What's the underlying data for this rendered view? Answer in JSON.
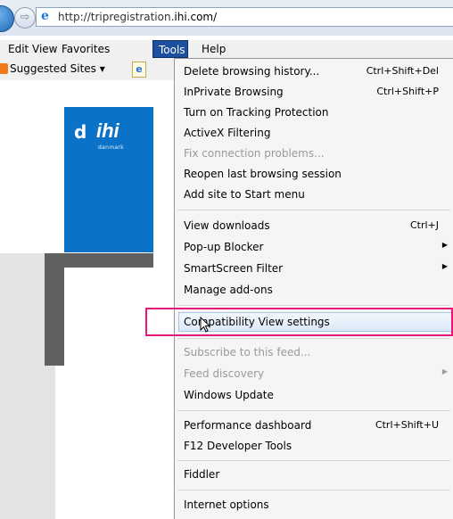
{
  "browser": {
    "address_url_prefix": "http://tripregistration.",
    "address_url_host": "ihi.com/",
    "forward_icon": "arrow-right-icon",
    "browser_icon": "ie-logo-icon"
  },
  "menubar": {
    "edit": "Edit",
    "view": "View",
    "favorites": "Favorites",
    "tools": "Tools",
    "help": "Help"
  },
  "favbar": {
    "suggested_sites": "Suggested Sites ▾"
  },
  "logo": {
    "text": "ihi",
    "sub": "danmark",
    "brand_color": "#0a72c7"
  },
  "tools_menu": {
    "items": [
      {
        "label": "Delete browsing history...",
        "shortcut": "Ctrl+Shift+Del"
      },
      {
        "label": "InPrivate Browsing",
        "shortcut": "Ctrl+Shift+P"
      },
      {
        "label": "Turn on Tracking Protection",
        "shortcut": ""
      },
      {
        "label": "ActiveX Filtering",
        "shortcut": ""
      },
      {
        "label": "Fix connection problems...",
        "shortcut": ""
      },
      {
        "label": "Reopen last browsing session",
        "shortcut": ""
      },
      {
        "label": "Add site to Start menu",
        "shortcut": ""
      },
      {
        "label": "View downloads",
        "shortcut": "Ctrl+J"
      },
      {
        "label": "Pop-up Blocker",
        "shortcut": ""
      },
      {
        "label": "SmartScreen Filter",
        "shortcut": ""
      },
      {
        "label": "Manage add-ons",
        "shortcut": ""
      },
      {
        "label": "Compatibility View settings",
        "shortcut": ""
      },
      {
        "label": "Subscribe to this feed...",
        "shortcut": ""
      },
      {
        "label": "Feed discovery",
        "shortcut": ""
      },
      {
        "label": "Windows Update",
        "shortcut": ""
      },
      {
        "label": "Performance dashboard",
        "shortcut": "Ctrl+Shift+U"
      },
      {
        "label": "F12 Developer Tools",
        "shortcut": ""
      },
      {
        "label": "Fiddler",
        "shortcut": ""
      },
      {
        "label": "Internet options",
        "shortcut": ""
      }
    ],
    "highlight_color": "#e6167a"
  }
}
